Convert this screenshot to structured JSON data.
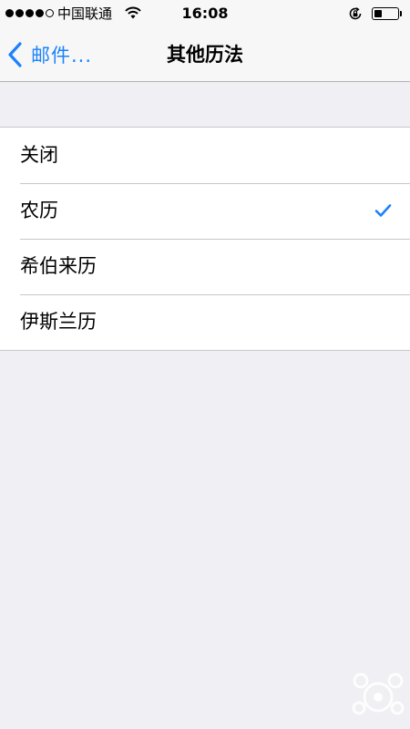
{
  "status_bar": {
    "carrier": "中国联通",
    "time": "16:08",
    "signal_bars_filled": 4,
    "signal_bars_total": 5,
    "wifi_icon": "wifi-icon",
    "lock_icon": "rotation-lock-icon",
    "battery_icon": "battery-icon",
    "battery_level": 0.35
  },
  "nav": {
    "back_label": "邮件...",
    "back_icon": "chevron-left-icon",
    "title": "其他历法"
  },
  "options": [
    {
      "label": "关闭",
      "selected": false
    },
    {
      "label": "农历",
      "selected": true
    },
    {
      "label": "希伯来历",
      "selected": false
    },
    {
      "label": "伊斯兰历",
      "selected": false
    }
  ],
  "check_icon": "checkmark-icon",
  "colors": {
    "accent": "#1a82fb",
    "background": "#efeff4",
    "bar": "#f7f7f8",
    "separator": "#c8c7cc"
  }
}
